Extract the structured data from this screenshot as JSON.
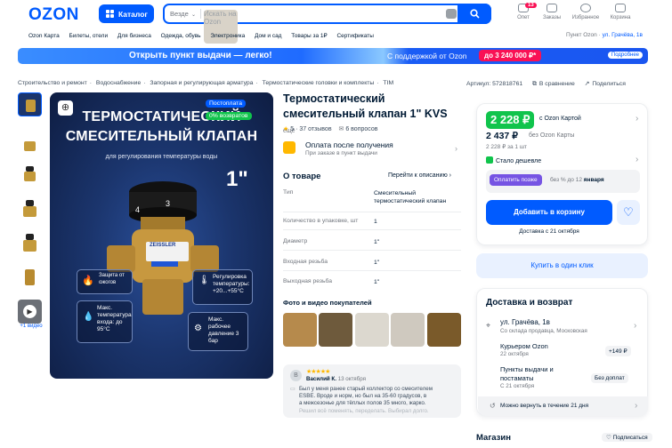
{
  "header": {
    "logo": "OZON",
    "catalog_label": "Каталог",
    "search_scope": "Везде",
    "search_placeholder": "Искать на Ozon",
    "nav": [
      {
        "label": "Опет",
        "badge": "13"
      },
      {
        "label": "Заказы"
      },
      {
        "label": "Избранное"
      },
      {
        "label": "Корзина"
      }
    ]
  },
  "subnav": {
    "items": [
      "Ozon Карта",
      "Билеты, отели",
      "Для бизнеса",
      "Одежда, обувь",
      "Электроника",
      "Дом и сад",
      "Товары за 1₽",
      "Сертификаты"
    ],
    "pickup_label": "Пункт Ozon · ",
    "pickup_address": "ул. Грачёва, 1в"
  },
  "banner": {
    "main": "Открыть пункт выдачи — легко!",
    "support": "С поддержкой от Ozon",
    "amount": "до 3 240 000 ₽*",
    "more": "Подробнее"
  },
  "breadcrumb": [
    "Строительство и ремонт",
    "Водоснабжение",
    "Запорная и регулирующая арматура",
    "Термостатические головки и комплекты",
    "TIM"
  ],
  "actions": {
    "article": "Артикул: 572818761",
    "compare": "В сравнение",
    "share": "Поделиться"
  },
  "gallery": {
    "video_label": "+1 видео",
    "image": {
      "headline1": "ТЕРМОСТАТИЧЕСКИЙ",
      "headline2": "СМЕСИТЕЛЬНЫЙ КЛАПАН",
      "subtitle": "для регулирования температуры воды",
      "size": "1\"",
      "brand": "ZEISSLER",
      "tag_postpay": "Постоплата",
      "tag_returns": "0% возвратов",
      "features": [
        {
          "id": "burn",
          "text": "Защита от ожогов"
        },
        {
          "id": "range",
          "text": "Регулировка температуры: +20...+55°C"
        },
        {
          "id": "inlet",
          "text": "Макс. температура входа: до 95°C"
        },
        {
          "id": "pressure",
          "text": "Макс. рабочее давление 3 бар"
        }
      ]
    }
  },
  "product": {
    "title": "Термостатический смесительный клапан 1\" KVS",
    "title_more": "ещё",
    "rating": "5",
    "reviews": "37 отзывов",
    "questions": "6 вопросов",
    "pay_title": "Оплата после получения",
    "pay_sub": "При заказе в пункт выдачи",
    "about_title": "О товаре",
    "to_description": "Перейти к описанию",
    "specs": [
      {
        "k": "Тип",
        "v": "Смесительный термостатический клапан"
      },
      {
        "k": "Количество в упаковке, шт",
        "v": "1"
      },
      {
        "k": "Диаметр",
        "v": "1\""
      },
      {
        "k": "Входная резьба",
        "v": "1\""
      },
      {
        "k": "Выходная резьба",
        "v": "1\""
      }
    ],
    "photos_title": "Фото и видео покупателей"
  },
  "review": {
    "avatar": "В",
    "author": "Василий К.",
    "date": "13 октября",
    "stars": 5,
    "text1": "Был у меня ранее старый коллектор со смесителем",
    "text2": "ESBE. Вроде и норм, но был на 35-60 градусов, в",
    "text3": "а межсезонье для тёплых полов 35 много, жарко.",
    "text4": "Решил всё поменять, переделать. Выбирал долго."
  },
  "price": {
    "card_price": "2 228 ₽",
    "card_label": "c Ozon Картой",
    "regular_price": "2 437 ₽",
    "regular_label": "без Ozon Карты",
    "per_unit": "2 228 ₽ за 1 шт",
    "cheaper": "Стало дешевле",
    "later_btn": "Оплатить позже",
    "later_text": "без % до 12",
    "later_month": "января",
    "cart_btn": "Добавить в корзину",
    "delivery_date": "Доставка с 21 октября",
    "buy_one": "Купить в один клик"
  },
  "delivery": {
    "title": "Доставка и возврат",
    "address": "ул. Грачёва, 1в",
    "address_sub": "Со склада продавца, Московская",
    "courier": "Курьером Ozon",
    "courier_date": "22 октября",
    "courier_price": "+149 ₽",
    "pickup": "Пункты выдачи и постаматы",
    "pickup_date": "С 21 октября",
    "pickup_price": "Без доплат",
    "return": "Можно вернуть в течение 21 дня"
  },
  "store": {
    "title": "Магазин",
    "subscribe": "Подписаться"
  }
}
